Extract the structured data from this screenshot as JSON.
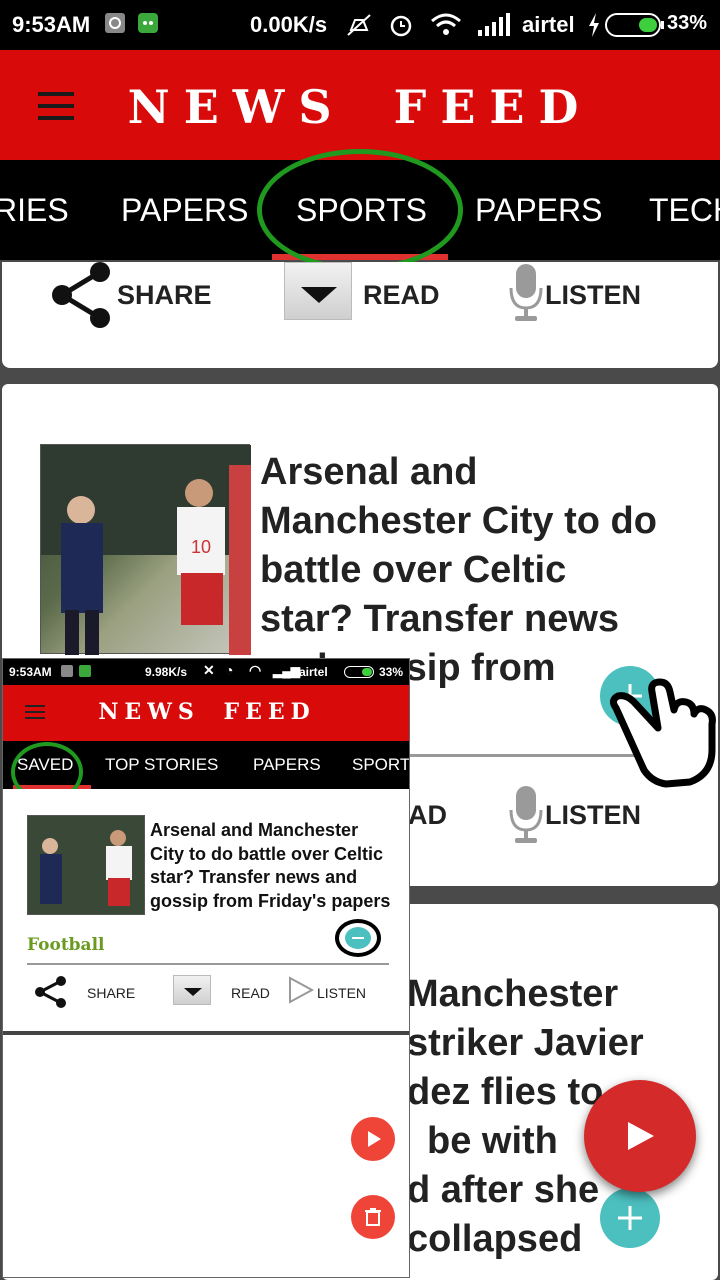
{
  "status": {
    "time": "9:53AM",
    "speed": "0.00K/s",
    "carrier": "airtel",
    "battery": "33%",
    "icons": [
      "photo-notification-icon",
      "app-notification-icon",
      "mute-icon",
      "alarm-icon",
      "wifi-icon",
      "signal-icon",
      "charging-icon",
      "battery-icon"
    ]
  },
  "app": {
    "title": "NEWS FEED"
  },
  "tabs": [
    "RIES",
    "PAPERS",
    "SPORTS",
    "PAPERS",
    "TECH"
  ],
  "top_card": {
    "share": "SHARE",
    "read": "READ",
    "listen": "LISTEN"
  },
  "article1": {
    "headline_lines": [
      "Arsenal and",
      "Manchester City to do",
      "battle over Celtic",
      "star? Transfer news",
      "and gossip from",
      "papers"
    ],
    "read": "AD",
    "listen": "LISTEN"
  },
  "article2": {
    "headline_lines": [
      "Manchester",
      "striker Javier",
      "dez flies to",
      "be with",
      "d after she",
      "collapsed"
    ]
  },
  "overlay": {
    "status": {
      "time": "9:53AM",
      "speed": "9.98K/s",
      "carrier": "airtel",
      "battery": "33%"
    },
    "title": "NEWS FEED",
    "tabs": [
      "SAVED",
      "TOP STORIES",
      "PAPERS",
      "SPORT"
    ],
    "headline": "Arsenal and Manchester City to do battle over Celtic star? Transfer news and gossip from Friday's papers",
    "category": "Football",
    "share": "SHARE",
    "read": "READ",
    "listen": "LISTEN"
  },
  "colors": {
    "app_red": "#d80a0a",
    "tab_bg": "#000000",
    "accent_teal": "#4cbfbf",
    "fab_red": "#d42a2a",
    "highlight_green": "#1f9a1f",
    "category_green": "#6a9a20"
  }
}
